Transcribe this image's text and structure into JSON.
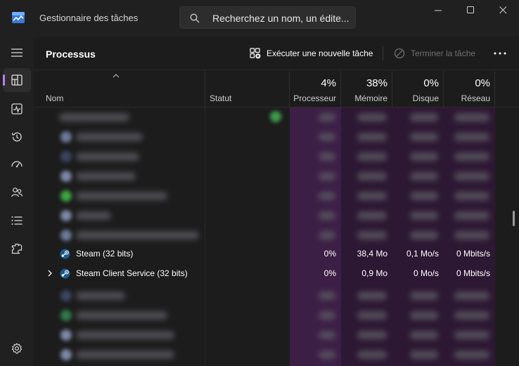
{
  "window": {
    "title": "Gestionnaire des tâches",
    "search_placeholder": "Recherchez un nom, un édite..."
  },
  "sidebar": {
    "items": [
      {
        "name": "hamburger-menu",
        "icon": "menu-icon"
      },
      {
        "name": "processus",
        "icon": "processes-icon",
        "active": true
      },
      {
        "name": "performances",
        "icon": "performance-icon"
      },
      {
        "name": "historique",
        "icon": "history-icon"
      },
      {
        "name": "demarrage",
        "icon": "startup-icon"
      },
      {
        "name": "utilisateurs",
        "icon": "users-icon"
      },
      {
        "name": "details",
        "icon": "details-icon"
      },
      {
        "name": "services",
        "icon": "services-icon"
      },
      {
        "name": "parametres",
        "icon": "settings-icon"
      }
    ]
  },
  "toolbar": {
    "title": "Processus",
    "new_task_label": "Exécuter une nouvelle tâche",
    "end_task_label": "Terminer la tâche"
  },
  "columns": {
    "name": "Nom",
    "status": "Statut",
    "cpu": {
      "pct": "4%",
      "label": "Processeur"
    },
    "memory": {
      "pct": "38%",
      "label": "Mémoire"
    },
    "disk": {
      "pct": "0%",
      "label": "Disque"
    },
    "network": {
      "pct": "0%",
      "label": "Réseau"
    }
  },
  "rows": [
    {
      "name": "Steam (32 bits)",
      "cpu": "0%",
      "memory": "38,4 Mo",
      "disk": "0,1 Mo/s",
      "network": "0 Mbits/s",
      "expandable": false
    },
    {
      "name": "Steam Client Service (32 bits)",
      "cpu": "0%",
      "memory": "0,9 Mo",
      "disk": "0 Mo/s",
      "network": "0 Mbits/s",
      "expandable": true
    }
  ],
  "colors": {
    "accent": "#c07bf0",
    "cpu_column_bg": "#3c1f45",
    "heat_column_bg": "#2d1833",
    "window_bg": "#202020",
    "content_bg": "#1c1c1c"
  }
}
